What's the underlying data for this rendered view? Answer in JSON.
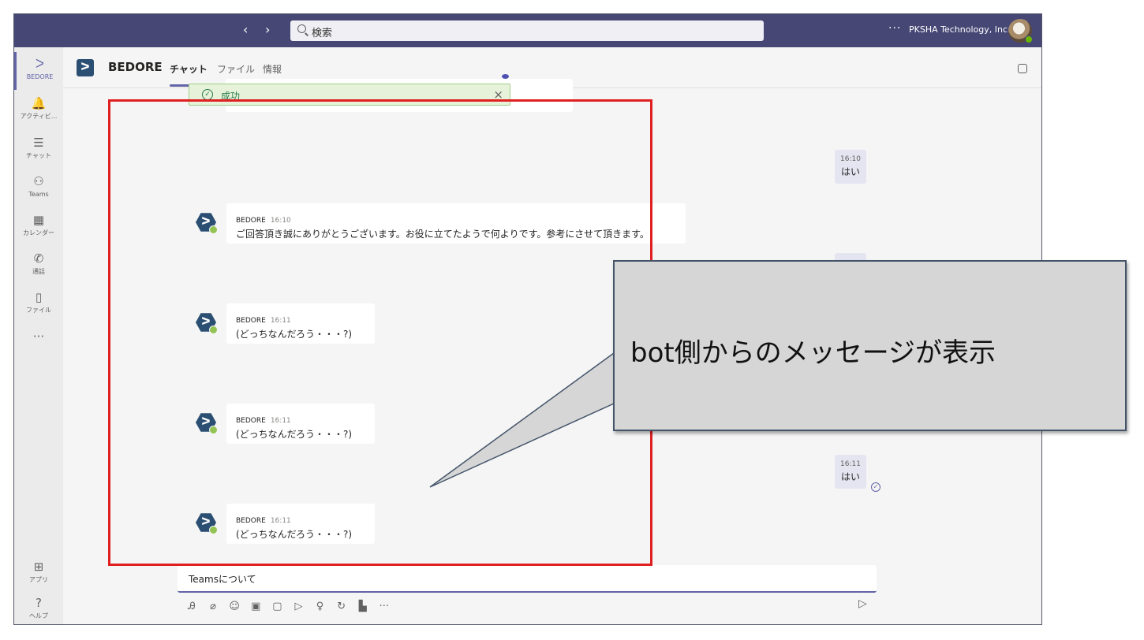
{
  "topbar": {
    "back": "‹",
    "forward": "›",
    "search_placeholder": "検索",
    "more": "···",
    "org": "PKSHA Technology, Inc."
  },
  "rail": [
    {
      "label": "BEDORE",
      "icon": "bedore-app-icon",
      "glyph": "ᐳ"
    },
    {
      "label": "アクティビ...",
      "icon": "bell-icon",
      "glyph": "🔔"
    },
    {
      "label": "チャット",
      "icon": "chat-icon",
      "glyph": "☰"
    },
    {
      "label": "Teams",
      "icon": "teams-icon",
      "glyph": "⚇"
    },
    {
      "label": "カレンダー",
      "icon": "calendar-icon",
      "glyph": "▦"
    },
    {
      "label": "通話",
      "icon": "phone-icon",
      "glyph": "✆"
    },
    {
      "label": "ファイル",
      "icon": "file-icon",
      "glyph": "▯"
    },
    {
      "label": "",
      "icon": "more-icon",
      "glyph": "···"
    },
    {
      "label": "アプリ",
      "icon": "apps-icon",
      "glyph": "⊞"
    },
    {
      "label": "ヘルプ",
      "icon": "help-icon",
      "glyph": "?"
    }
  ],
  "header": {
    "team_name": "BEDORE",
    "tabs": [
      "チャット",
      "ファイル",
      "情報"
    ],
    "logo_glyph": "ᐳ"
  },
  "chat": {
    "success_label": "成功",
    "success_icon": "✓",
    "close": "×",
    "bot_messages": [
      {
        "sender": "BEDORE",
        "time": "16:10",
        "text": "ご回答頂き誠にありがとうございます。お役に立てたようで何よりです。参考にさせて頂きます。"
      },
      {
        "sender": "BEDORE",
        "time": "16:11",
        "text": "(どっちなんだろう・・・?)"
      },
      {
        "sender": "BEDORE",
        "time": "16:11",
        "text": "(どっちなんだろう・・・?)"
      },
      {
        "sender": "BEDORE",
        "time": "16:11",
        "text": "(どっちなんだろう・・・?)"
      }
    ],
    "user_messages": [
      {
        "time": "16:10",
        "text": "はい"
      },
      {
        "time": "16:11",
        "text": "はい"
      }
    ],
    "read_receipt": "✓"
  },
  "compose": {
    "value": "Teamsについて",
    "tools": [
      {
        "icon": "format-icon",
        "glyph": "Ꭿ"
      },
      {
        "icon": "attach-icon",
        "glyph": "⌀"
      },
      {
        "icon": "emoji-icon",
        "glyph": "☺"
      },
      {
        "icon": "gif-icon",
        "glyph": "▣"
      },
      {
        "icon": "sticker-icon",
        "glyph": "▢"
      },
      {
        "icon": "meet-icon",
        "glyph": "▷"
      },
      {
        "icon": "praise-icon",
        "glyph": "♀"
      },
      {
        "icon": "loop-icon",
        "glyph": "↻"
      },
      {
        "icon": "approvals-icon",
        "glyph": "▙"
      },
      {
        "icon": "more-icon",
        "glyph": "···"
      }
    ],
    "send": "▷"
  },
  "annotation": {
    "callout_text": "bot側からのメッセージが表示"
  },
  "colors": {
    "topbar": "#464775",
    "accent": "#6264a7",
    "highlight": "#e02020",
    "callout_bg": "#d6d6d6"
  }
}
